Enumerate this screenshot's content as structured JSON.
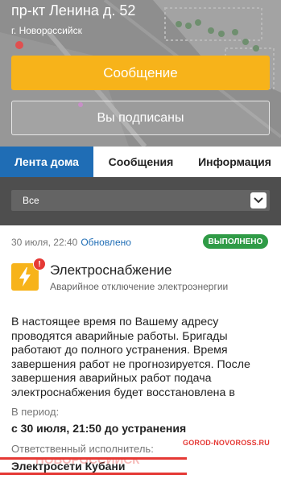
{
  "header": {
    "address": "пр-кт Ленина д. 52",
    "city": "г. Новороссийск",
    "message_button": "Сообщение",
    "subscribed_button": "Вы подписаны"
  },
  "tabs": [
    {
      "label": "Лента дома",
      "active": true
    },
    {
      "label": "Сообщения",
      "active": false
    },
    {
      "label": "Информация",
      "active": false
    }
  ],
  "filter": {
    "selected": "Все",
    "icon": "chevron-down-icon"
  },
  "post": {
    "date": "30 июля, 22:40",
    "updated": "Обновлено",
    "status": "ВЫПОЛНЕНО",
    "status_color": "#2f9b46",
    "category_icon": "lightning-icon",
    "alert_mark": "!",
    "title": "Электроснабжение",
    "subtitle": "Аварийное отключение электроэнергии",
    "description": "В настоящее время по Вашему адресу проводятся аварийные работы. Бригады работают до полного устранения. Время завершения работ не прогнозируется. После завершения аварийных работ подача электроснабжения будет восстановлена в",
    "period_label": "В период:",
    "period_value": "с 30 июля, 21:50 до устранения",
    "executor_label": "Ответственный исполнитель:",
    "executor_value": "Электросети Кубани"
  },
  "watermark": {
    "text": "GOROD-NOVOROSS.RU",
    "ribbon_text": "НОВОРОССИЙСК"
  },
  "colors": {
    "accent_blue": "#1f6db5",
    "accent_yellow": "#f7b31a",
    "dark_bar": "#4e4e4e",
    "watermark_red": "#e53935"
  }
}
